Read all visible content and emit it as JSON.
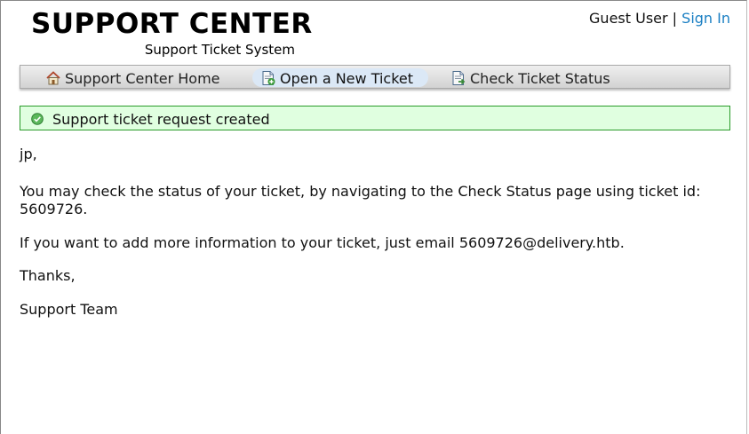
{
  "header": {
    "logo_title": "SUPPORT CENTER",
    "logo_subtitle": "Support Ticket System",
    "user_label": "Guest User",
    "separator": "|",
    "sign_in_label": "Sign In"
  },
  "nav": {
    "items": [
      {
        "label": "Support Center Home",
        "icon": "home-icon"
      },
      {
        "label": "Open a New Ticket",
        "icon": "new-ticket-icon",
        "active": true
      },
      {
        "label": "Check Ticket Status",
        "icon": "ticket-status-icon"
      }
    ]
  },
  "notice": {
    "message": "Support ticket request created",
    "icon": "check-circle-icon",
    "colors": {
      "background": "#e0ffe0",
      "border": "#2a9b2a"
    }
  },
  "body": {
    "greeting": "jp,",
    "status_text": "You may check the status of your ticket, by navigating to the Check Status page using ticket id: 5609726.",
    "email_text": "If you want to add more information to your ticket, just email 5609726@delivery.htb.",
    "thanks": "Thanks,",
    "signature": "Support Team"
  },
  "colors": {
    "link": "#1a7fc3",
    "active_tab": "#dbe8f6"
  }
}
